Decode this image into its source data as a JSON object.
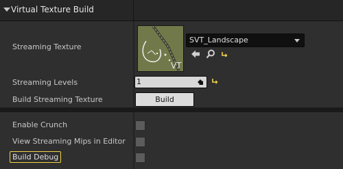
{
  "header": {
    "title": "Virtual Texture Build"
  },
  "streaming_texture": {
    "label": "Streaming Texture",
    "thumbnail_overlay": "VT",
    "selected_asset": "SVT_Landscape"
  },
  "streaming_levels": {
    "label": "Streaming Levels",
    "value": "1"
  },
  "build_streaming_texture": {
    "label": "Build Streaming Texture",
    "button_label": "Build"
  },
  "options": [
    {
      "label": "Enable Crunch",
      "checked": false
    },
    {
      "label": "View Streaming Mips in Editor",
      "checked": false
    },
    {
      "label": "Build Debug",
      "checked": false
    }
  ],
  "colors": {
    "panel_bg": "#2f2f2f",
    "header_bg": "#262626",
    "focus_outline": "#f2d44a",
    "reset_arrow": "#f2d44a"
  },
  "icons": {
    "collapse": "chevron-down-icon",
    "use_selected": "arrow-left-icon",
    "browse": "search-icon",
    "reset": "reset-to-default-icon",
    "numeric_drag": "drag-handle-icon"
  }
}
